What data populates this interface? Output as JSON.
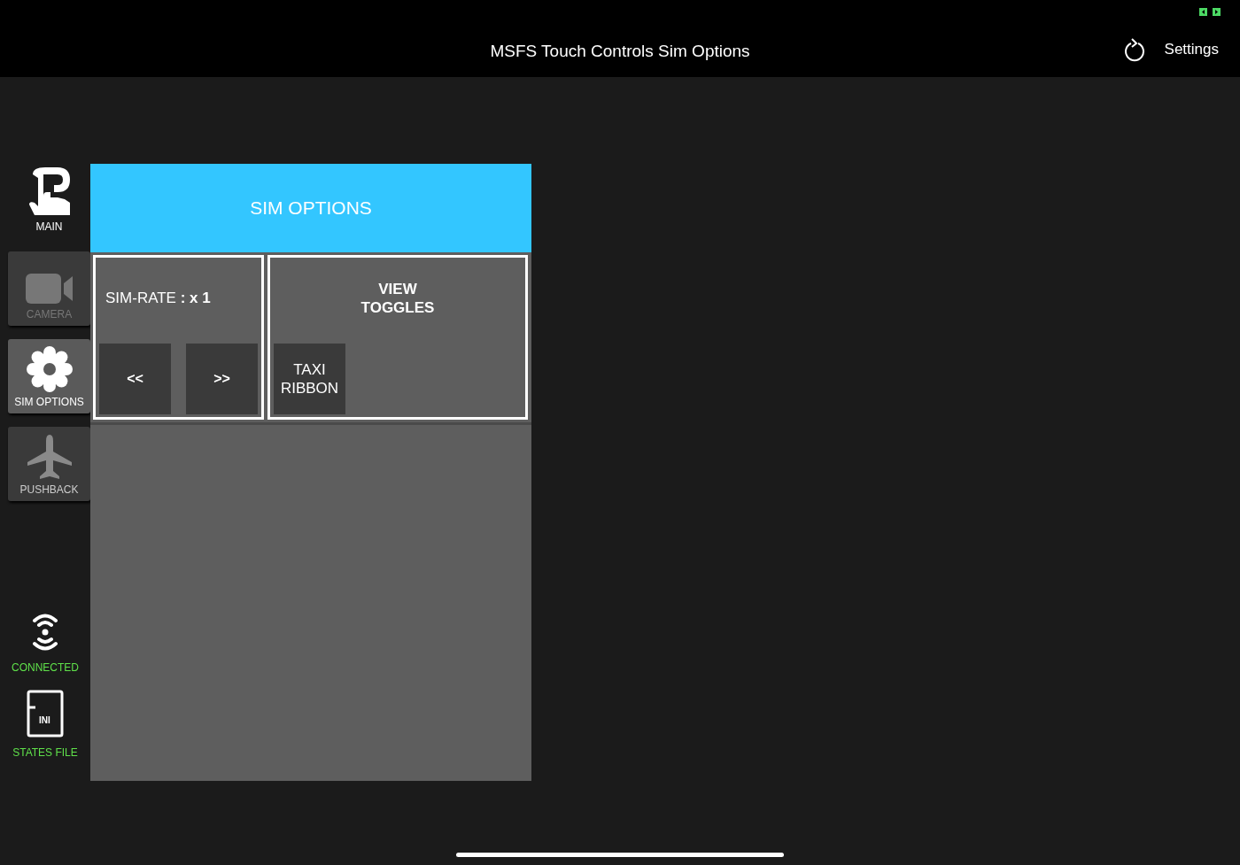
{
  "header": {
    "title": "MSFS Touch Controls Sim Options",
    "settings_label": "Settings"
  },
  "nav": [
    {
      "label": "MAIN",
      "kind": "logo",
      "selected": false,
      "disabled": false
    },
    {
      "label": "CAMERA",
      "kind": "camera",
      "selected": false,
      "disabled": true
    },
    {
      "label": "SIM OPTIONS",
      "kind": "gear",
      "selected": true,
      "disabled": false
    },
    {
      "label": "PUSHBACK",
      "kind": "plane",
      "selected": false,
      "disabled": false
    }
  ],
  "status": [
    {
      "label": "CONNECTED",
      "kind": "signal"
    },
    {
      "label": "STATES FILE",
      "kind": "file",
      "icon_text": "INI"
    }
  ],
  "panel": {
    "title": "SIM OPTIONS",
    "sim_rate": {
      "label": "SIM-RATE",
      "value": ": x 1",
      "buttons": [
        "<<",
        ">>"
      ]
    },
    "view_toggles": {
      "title": "VIEW\nTOGGLES",
      "buttons": [
        "TAXI\nRIBBON"
      ]
    }
  }
}
